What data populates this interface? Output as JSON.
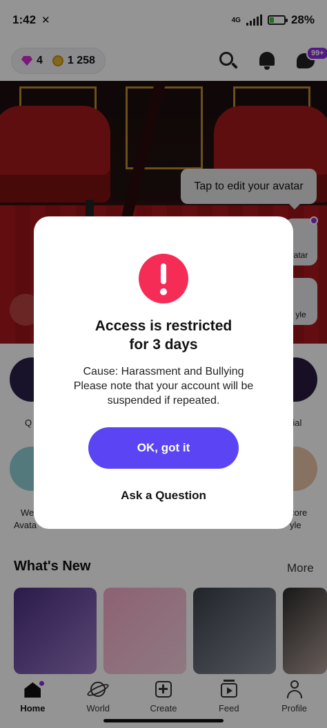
{
  "status_bar": {
    "time": "1:42",
    "network": "4G",
    "battery": "28%"
  },
  "top_bar": {
    "gems": "4",
    "coins": "1 258",
    "chat_badge": "99+"
  },
  "hero": {
    "tooltip": "Tap to edit your avatar",
    "side_buttons": [
      "atar",
      "yle"
    ]
  },
  "shortcuts": {
    "labels": [
      "Q",
      "rial",
      "Wel",
      "Avata",
      "core",
      "yle"
    ]
  },
  "whats_new": {
    "title": "What's New",
    "more": "More"
  },
  "bottom_nav": {
    "items": [
      "Home",
      "World",
      "Create",
      "Feed",
      "Profile"
    ],
    "active": "Home"
  },
  "modal": {
    "title_line1": "Access is restricted",
    "title_line2": "for 3 days",
    "body_line1": "Cause: Harassment and Bullying",
    "body_line2": "Please note that your account will be",
    "body_line3": "suspended if repeated.",
    "ok_label": "OK, got it",
    "ask_label": "Ask a Question"
  },
  "colors": {
    "accent": "#5b44f4",
    "alert": "#f52d56",
    "badge": "#8e2be0"
  }
}
